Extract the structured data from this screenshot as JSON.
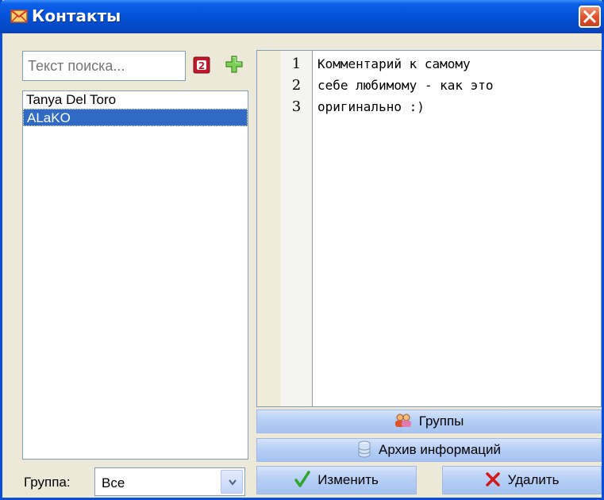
{
  "window": {
    "title": "Контакты",
    "icon": "contacts-envelope-icon",
    "close_icon": "close-icon"
  },
  "search": {
    "placeholder": "Текст поиска...",
    "value": "Текст поиска...",
    "clear_icon": "clear-search-icon",
    "add_icon": "add-contact-icon"
  },
  "contacts": {
    "items": [
      {
        "label": "Tanya Del Toro",
        "selected": false
      },
      {
        "label": "ALaKO",
        "selected": true
      }
    ]
  },
  "group": {
    "label": "Группа:",
    "selected": "Все"
  },
  "editor": {
    "line_numbers": [
      "1",
      "2",
      "3"
    ],
    "lines": [
      "Комментарий к самому",
      "себе любимому - как это",
      "оригинально :)"
    ]
  },
  "buttons": {
    "groups": "Группы",
    "archive": "Архив информаций",
    "edit": "Изменить",
    "delete": "Удалить"
  },
  "colors": {
    "titlebar": "#0452d6",
    "selection": "#316ac5",
    "button_face": "#b3cdf4",
    "close": "#e2532c"
  }
}
